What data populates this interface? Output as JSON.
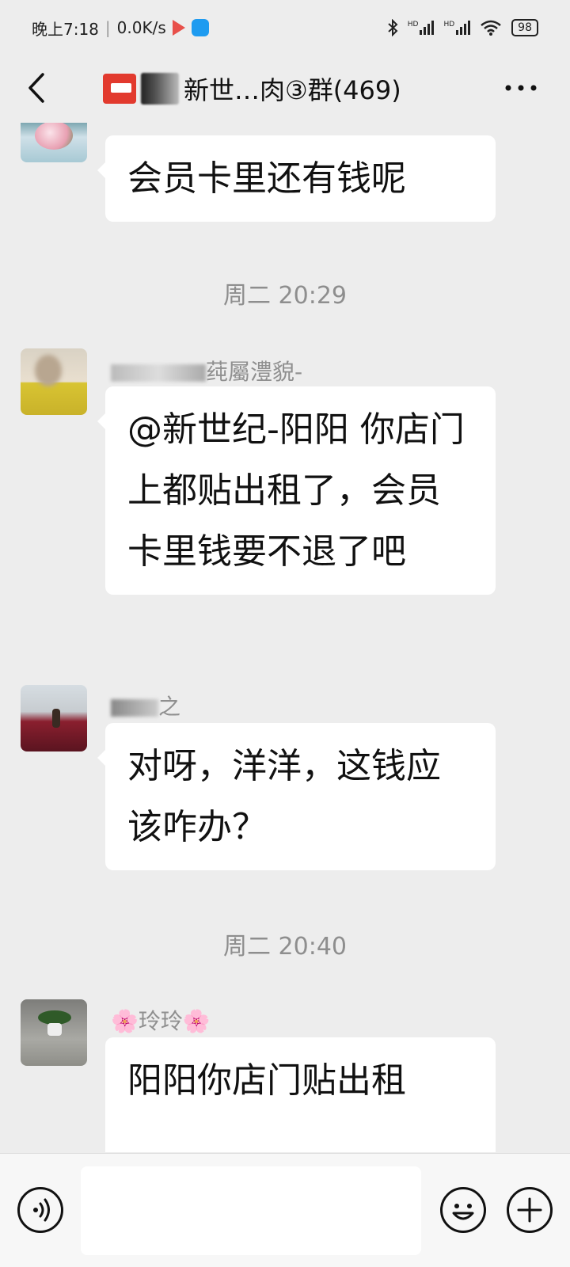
{
  "status_bar": {
    "time": "晚上7:18",
    "separator": "|",
    "network_speed": "0.0K/s",
    "signal_1": "HD",
    "signal_2": "HD",
    "battery": "98"
  },
  "header": {
    "title": "新世…肉③群(469)",
    "back_icon": "chevron-left-icon",
    "more_icon": "more-dots-icon"
  },
  "messages": [
    {
      "type": "message",
      "sender": "",
      "text": "会员卡里还有钱呢"
    },
    {
      "type": "time",
      "text": "周二 20:29"
    },
    {
      "type": "message",
      "sender": "莼屬澧貌-",
      "text": "@新世纪-阳阳 你店门上都贴出租了，会员卡里钱要不退了吧"
    },
    {
      "type": "message",
      "sender": "之",
      "text": "对呀，洋洋，这钱应该咋办？"
    },
    {
      "type": "time",
      "text": "周二 20:40"
    },
    {
      "type": "message",
      "sender": "🌸玲玲🌸",
      "text": "阳阳你店门贴出租"
    }
  ],
  "input_bar": {
    "voice_icon": "voice-icon",
    "emoji_icon": "emoji-icon",
    "plus_icon": "plus-icon"
  },
  "colors": {
    "background": "#ededed",
    "bubble": "#ffffff",
    "timestamp": "#8e8e8e",
    "sender_name": "#8f8f8f",
    "group_avatar": "#e23a2e"
  }
}
